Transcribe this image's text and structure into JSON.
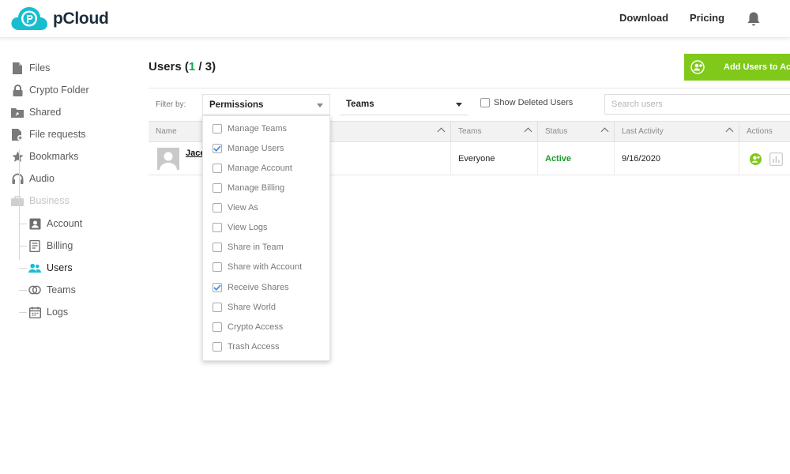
{
  "header": {
    "brand": "pCloud",
    "nav": [
      {
        "label": "Download"
      },
      {
        "label": "Pricing"
      }
    ]
  },
  "sidebar": {
    "items": [
      {
        "label": "Files",
        "icon": "file-icon"
      },
      {
        "label": "Crypto Folder",
        "icon": "lock-icon"
      },
      {
        "label": "Shared",
        "icon": "shared-folder-icon"
      },
      {
        "label": "File requests",
        "icon": "file-request-icon"
      },
      {
        "label": "Bookmarks",
        "icon": "star-icon"
      },
      {
        "label": "Audio",
        "icon": "headphones-icon"
      },
      {
        "label": "Business",
        "icon": "briefcase-icon",
        "disabled": true
      }
    ],
    "business_items": [
      {
        "label": "Account",
        "icon": "account-icon"
      },
      {
        "label": "Billing",
        "icon": "billing-icon"
      },
      {
        "label": "Users",
        "icon": "users-icon",
        "active": true
      },
      {
        "label": "Teams",
        "icon": "teams-icon"
      },
      {
        "label": "Logs",
        "icon": "calendar-icon"
      }
    ]
  },
  "main": {
    "title_prefix": "Users (",
    "title_shown": "1",
    "title_sep": " / ",
    "title_total": "3",
    "title_suffix": ")",
    "add_button_label": "Add Users to Account",
    "filter_label": "Filter by:",
    "permissions_select": "Permissions",
    "teams_select": "Teams",
    "show_deleted_label": "Show Deleted Users",
    "search_placeholder": "Search users"
  },
  "table": {
    "columns": [
      {
        "label": "Name"
      },
      {
        "label": "Teams"
      },
      {
        "label": "Status"
      },
      {
        "label": "Last Activity"
      },
      {
        "label": "Actions"
      }
    ],
    "rows": [
      {
        "name": "Jace",
        "teams": "Everyone",
        "status": "Active",
        "last_activity": "9/16/2020"
      }
    ]
  },
  "permissions_dropdown": {
    "options": [
      {
        "label": "Manage Teams",
        "checked": false
      },
      {
        "label": "Manage Users",
        "checked": true
      },
      {
        "label": "Manage Account",
        "checked": false
      },
      {
        "label": "Manage Billing",
        "checked": false
      },
      {
        "label": "View As",
        "checked": false
      },
      {
        "label": "View Logs",
        "checked": false
      },
      {
        "label": "Share in Team",
        "checked": false
      },
      {
        "label": "Share with Account",
        "checked": false
      },
      {
        "label": "Receive Shares",
        "checked": true
      },
      {
        "label": "Share World",
        "checked": false
      },
      {
        "label": "Crypto Access",
        "checked": false
      },
      {
        "label": "Trash Access",
        "checked": false
      }
    ]
  },
  "colors": {
    "brand": "#17bed0",
    "accent_green": "#80c91a",
    "status_active": "#1b9c2a",
    "checkbox_checked": "#4a8fe0"
  }
}
